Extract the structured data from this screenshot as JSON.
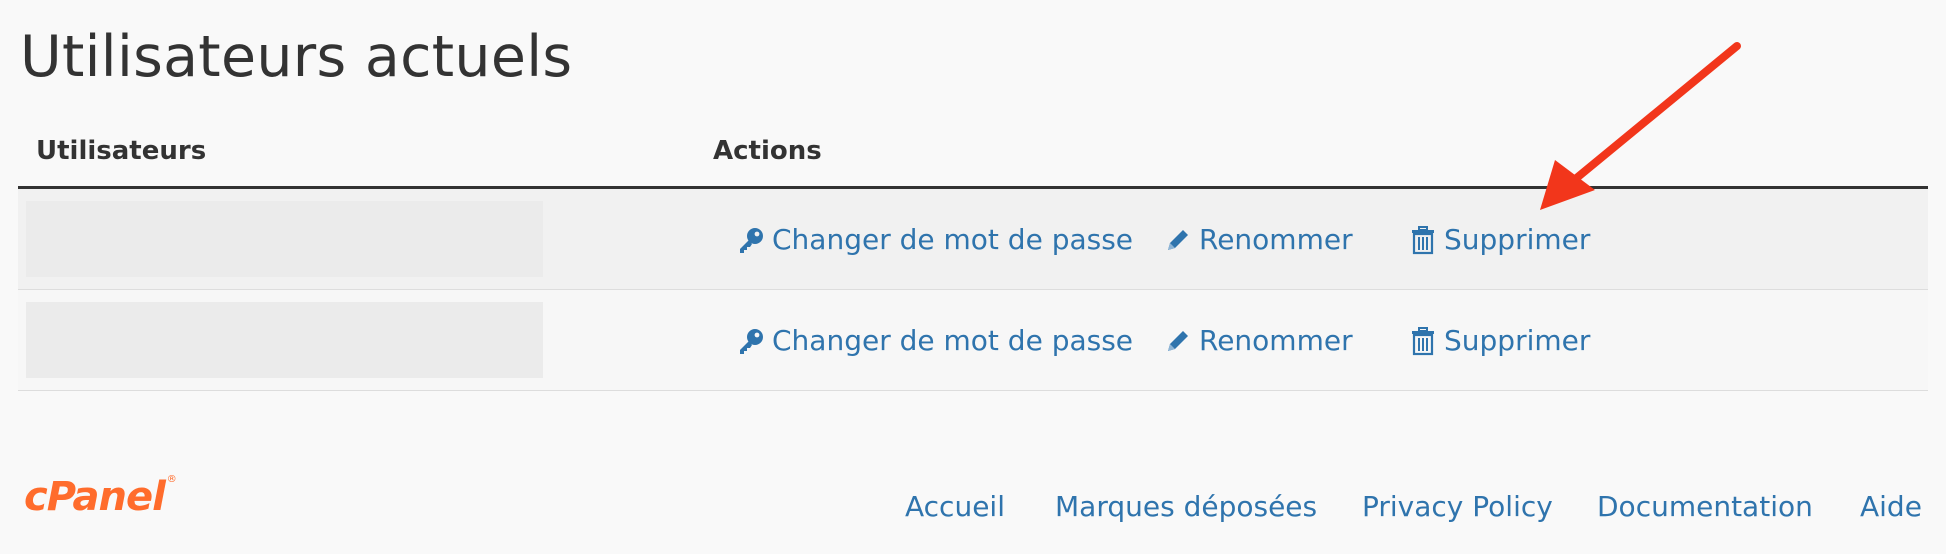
{
  "page": {
    "title": "Utilisateurs actuels"
  },
  "table": {
    "headers": {
      "users": "Utilisateurs",
      "actions": "Actions"
    },
    "rows": [
      {
        "user": "",
        "change_password": "Changer de mot de passe",
        "rename": "Renommer",
        "delete": "Supprimer"
      },
      {
        "user": "",
        "change_password": "Changer de mot de passe",
        "rename": "Renommer",
        "delete": "Supprimer"
      }
    ]
  },
  "icons": {
    "change_password": "key-icon",
    "rename": "pencil-icon",
    "delete": "trash-icon",
    "annotation": "red-arrow-icon"
  },
  "colors": {
    "link": "#2f74ad",
    "brand": "#ff6c2c",
    "annotation_arrow": "#f2361b"
  },
  "footer": {
    "logo": "cPanel",
    "links": [
      "Accueil",
      "Marques déposées",
      "Privacy Policy",
      "Documentation",
      "Aide"
    ]
  }
}
